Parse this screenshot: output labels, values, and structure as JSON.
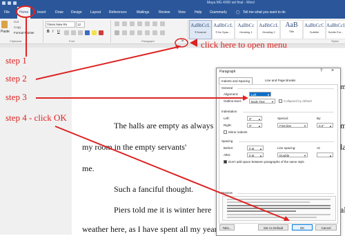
{
  "window": {
    "title": "Maya MG 4000 wd final - Word"
  },
  "tabs": [
    "File",
    "Home",
    "Insert",
    "Draw",
    "Design",
    "Layout",
    "References",
    "Mailings",
    "Review",
    "View",
    "Help",
    "Grammarly"
  ],
  "tell_me": "Tell me what you want to do",
  "ribbon": {
    "clipboard": {
      "paste": "Paste",
      "cut": "Cut",
      "copy": "Copy",
      "format_painter": "Format Painter",
      "group": "Clipboard"
    },
    "font": {
      "name": "Times New Ro",
      "size": "12",
      "group": "Font"
    },
    "paragraph": {
      "group": "Paragraph"
    },
    "styles": {
      "items": [
        {
          "sample": "AaBbCcL",
          "name": "¶ Normal"
        },
        {
          "sample": "AaBbCcL",
          "name": "¶ No Spac..."
        },
        {
          "sample": "AaBbCc",
          "name": "Heading 1"
        },
        {
          "sample": "AaBbCcL",
          "name": "Heading 2"
        },
        {
          "sample": "AaB",
          "name": "Title"
        },
        {
          "sample": "AaBbCcC",
          "name": "Subtitle"
        },
        {
          "sample": "AaBbCcL",
          "name": "Subtle Em..."
        },
        {
          "sample": "AaBbCcL",
          "name": "Emp"
        }
      ],
      "group": "Styles"
    }
  },
  "annotations": {
    "step1": "step 1",
    "step2": "step 2",
    "step3": "step 3",
    "step4": "step 4 - click OK",
    "open_menu": "click here to open menu"
  },
  "document": {
    "lines": [
      "The halls are empty as always",
      "my room in the empty servants'",
      "me.",
      "Such a fanciful thought.",
      "Piers told me it is winter here",
      "weather here, as I have spent all my years of servitude indoors. Tryin"
    ],
    "right_fragments": [
      "m",
      "m",
      "lar",
      "all"
    ]
  },
  "dialog": {
    "title": "Paragraph",
    "help": "?",
    "tabs": [
      "Indents and Spacing",
      "Line and Page Breaks"
    ],
    "general": {
      "heading": "General",
      "alignment_label": "Alignment:",
      "alignment_value": "Left",
      "outline_label": "Outline level:",
      "outline_value": "Body Text",
      "collapsed_label": "Collapsed by default"
    },
    "indentation": {
      "heading": "Indentation",
      "left_label": "Left:",
      "left_value": "0\"",
      "right_label": "Right:",
      "right_value": "0\"",
      "special_label": "Special:",
      "special_value": "First line",
      "by_label": "By:",
      "by_value": "0.2\"",
      "mirror_label": "Mirror indents"
    },
    "spacing": {
      "heading": "Spacing",
      "before_label": "Before:",
      "before_value": "0 pt",
      "after_label": "After:",
      "after_value": "0 pt",
      "line_label": "Line spacing:",
      "line_value": "Double",
      "at_label": "At:",
      "dont_add_label": "Don't add space between paragraphs of the same style"
    },
    "preview": {
      "heading": "Preview"
    },
    "buttons": {
      "tabs": "Tabs...",
      "default": "Set As Default",
      "ok": "OK",
      "cancel": "Cancel"
    }
  },
  "colors": {
    "word_blue": "#2b579a",
    "annotation_red": "#dd2222",
    "ok_border": "#0078d7"
  }
}
